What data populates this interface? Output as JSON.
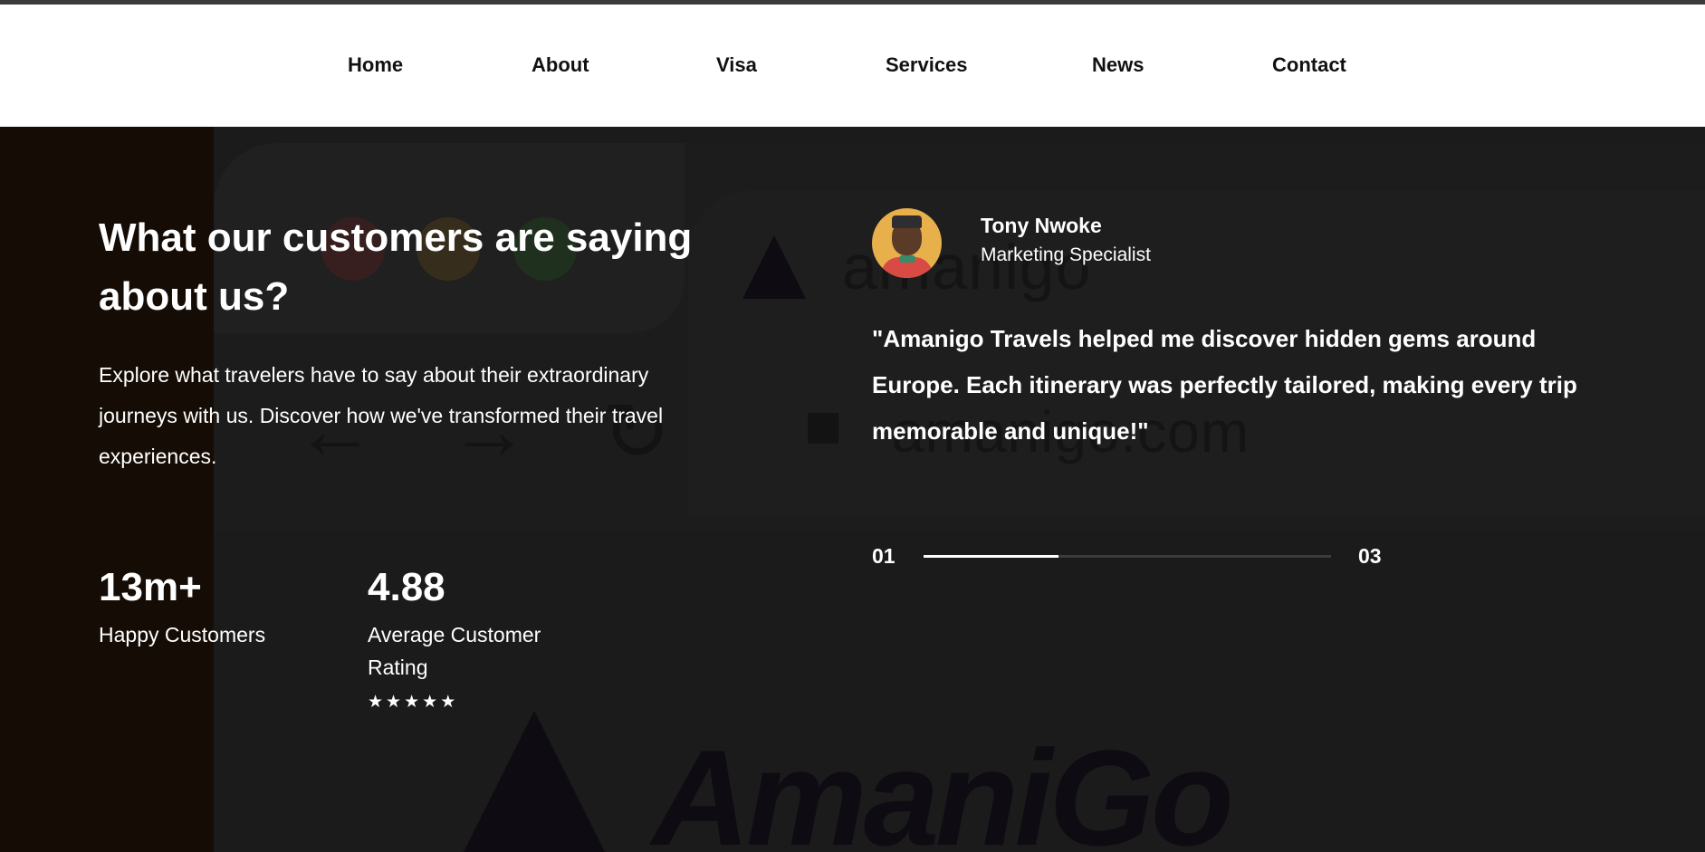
{
  "nav": {
    "items": [
      {
        "label": "Home"
      },
      {
        "label": "About"
      },
      {
        "label": "Visa"
      },
      {
        "label": "Services"
      },
      {
        "label": "News"
      },
      {
        "label": "Contact"
      }
    ]
  },
  "background": {
    "url_text": "amanigo.com",
    "tab_text": "amanigo",
    "logo_text": "AmaniGo"
  },
  "section": {
    "title": "What our customers are saying about us?",
    "intro": "Explore what travelers have to say about their extraordinary journeys with us. Discover how we've transformed their travel experiences."
  },
  "stats": [
    {
      "value": "13m+",
      "label": "Happy Customers"
    },
    {
      "value": "4.88",
      "label": "Average Customer Rating",
      "stars": 5
    }
  ],
  "testimonial": {
    "name": "Tony Nwoke",
    "role": "Marketing Specialist",
    "quote": "\"Amanigo Travels helped me discover hidden gems around Europe. Each itinerary was perfectly tailored, making every trip memorable and unique!\""
  },
  "slider": {
    "current": "01",
    "total": "03",
    "progress": 0.33
  },
  "colors": {
    "background": "#1b1b1b",
    "left_strip": "#150d05",
    "text": "#ffffff",
    "avatar_bg": "#e8b04a"
  }
}
